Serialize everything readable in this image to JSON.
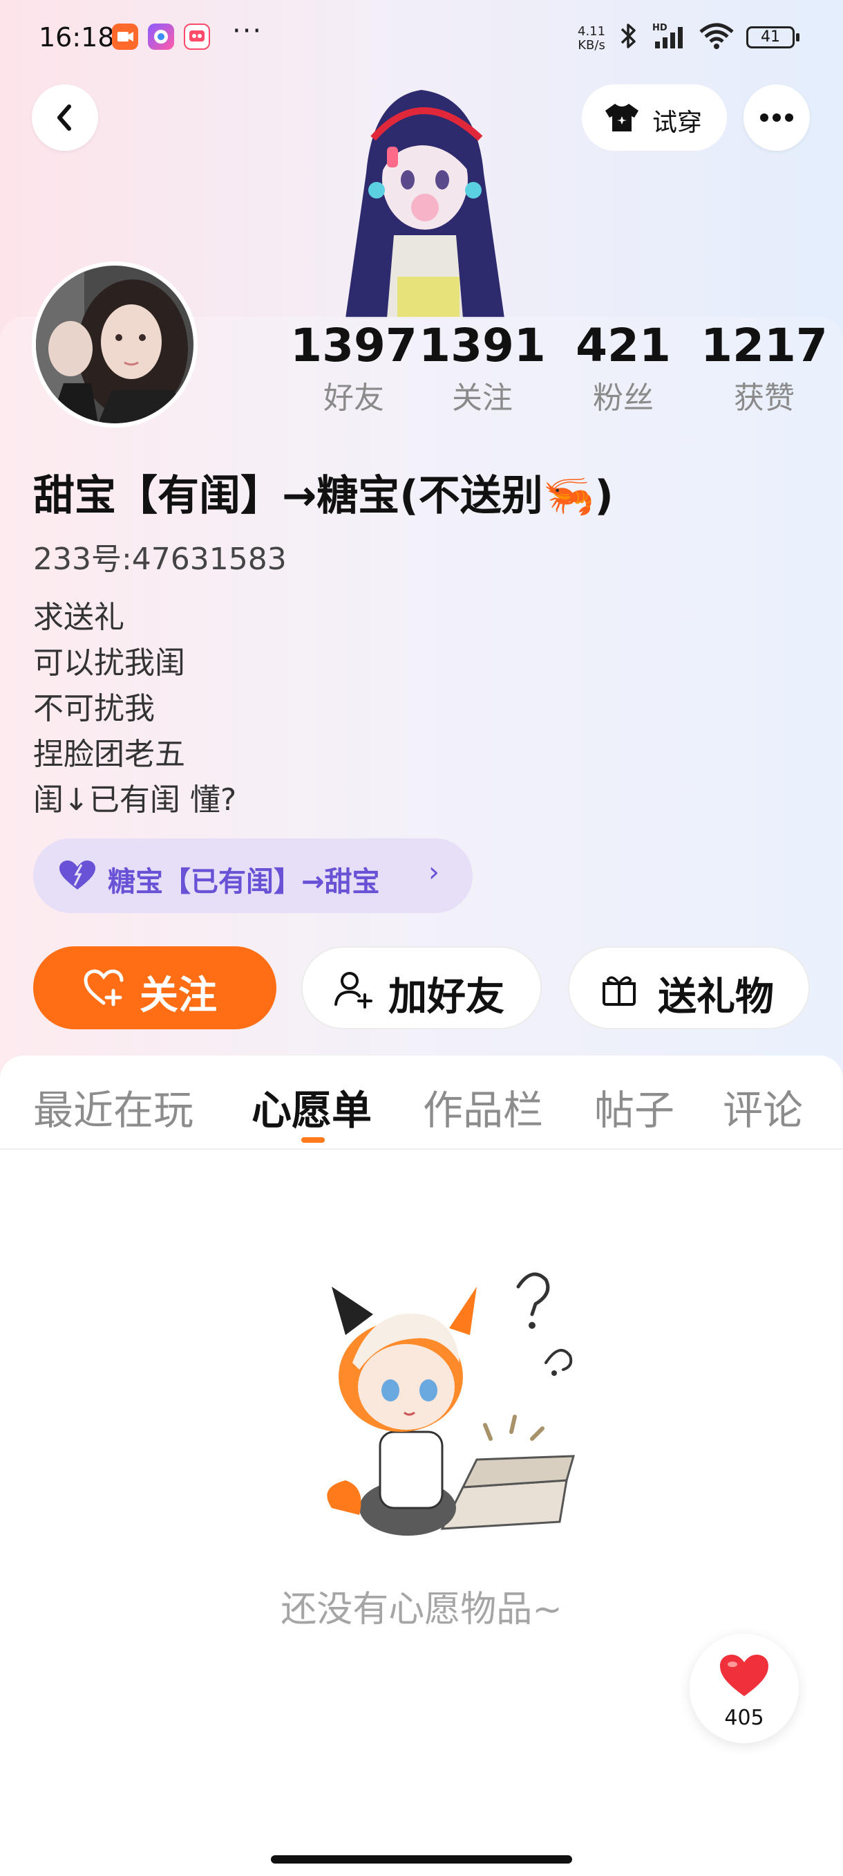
{
  "status_bar": {
    "time": "16:18",
    "dots": "···",
    "net_speed_value": "4.11",
    "net_speed_unit": "KB/s",
    "battery": "41",
    "app_icons": [
      "video-app-icon",
      "camera-app-icon",
      "game-app-icon"
    ]
  },
  "header": {
    "back_icon": "chevron-left-icon",
    "try_on_label": "试穿",
    "try_on_icon": "tshirt-icon",
    "more_icon": "more-dots-icon"
  },
  "profile": {
    "stats": [
      {
        "value": "1397",
        "label": "好友"
      },
      {
        "value": "1391",
        "label": "关注"
      },
      {
        "value": "421",
        "label": "粉丝"
      },
      {
        "value": "1217",
        "label": "获赞"
      }
    ],
    "nickname": "甜宝【有闺】→糖宝(不送别🦐)",
    "uid": "233号:47631583",
    "bio_lines": [
      "求送礼",
      "可以扰我闺",
      "不可扰我",
      "捏脸团老五",
      "闺↓已有闺 懂?"
    ],
    "cp_badge": {
      "label": "糖宝【已有闺】→甜宝",
      "chevron": "›"
    }
  },
  "actions": {
    "follow": "关注",
    "add_friend": "加好友",
    "send_gift": "送礼物"
  },
  "tabs": [
    {
      "label": "最近在玩",
      "active": false
    },
    {
      "label": "心愿单",
      "active": true
    },
    {
      "label": "作品栏",
      "active": false
    },
    {
      "label": "帖子",
      "active": false
    },
    {
      "label": "评论",
      "active": false
    }
  ],
  "empty_state": {
    "text": "还没有心愿物品~"
  },
  "like_fab": {
    "count": "405"
  },
  "colors": {
    "accent_orange": "#ff6e14",
    "badge_purple": "#6a52d6",
    "badge_bg": "#e6dff7"
  }
}
